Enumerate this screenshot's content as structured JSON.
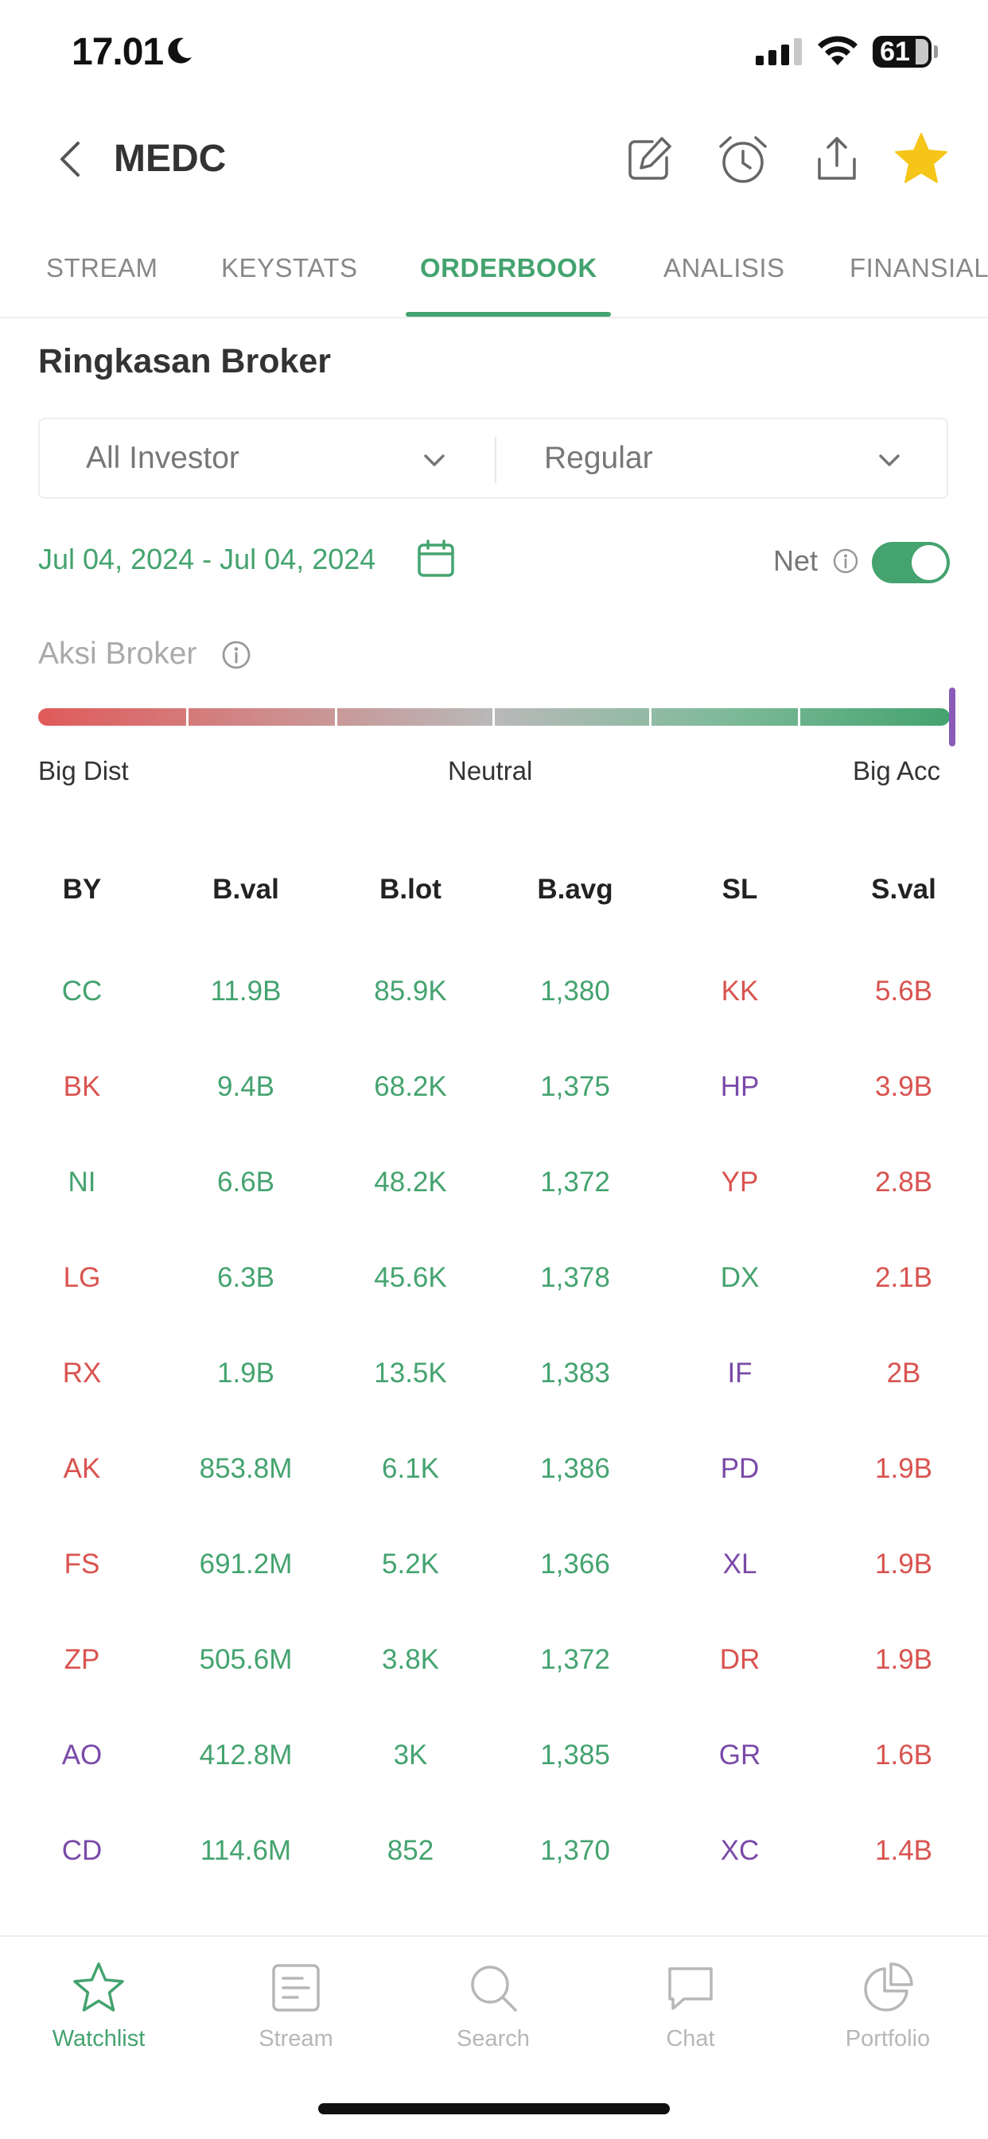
{
  "status_bar": {
    "time": "17.01",
    "battery": "61"
  },
  "header": {
    "ticker": "MEDC"
  },
  "tabs": [
    {
      "label": "STREAM",
      "active": false
    },
    {
      "label": "KEYSTATS",
      "active": false
    },
    {
      "label": "ORDERBOOK",
      "active": true
    },
    {
      "label": "ANALISIS",
      "active": false
    },
    {
      "label": "FINANSIAL",
      "active": false
    }
  ],
  "broker_summary": {
    "title": "Ringkasan Broker",
    "investor_filter": "All Investor",
    "market_filter": "Regular",
    "date_range": "Jul 04, 2024 - Jul 04, 2024",
    "net_label": "Net",
    "net_enabled": true,
    "aksi_label": "Aksi Broker",
    "scale": {
      "left": "Big Dist",
      "center": "Neutral",
      "right": "Big Acc"
    },
    "indicator_level": 1.0
  },
  "table": {
    "headers": [
      "BY",
      "B.val",
      "B.lot",
      "B.avg",
      "SL",
      "S.val"
    ],
    "rows": [
      {
        "by": "CC",
        "by_color": "green",
        "bval": "11.9B",
        "blot": "85.9K",
        "bavg": "1,380",
        "sl": "KK",
        "sl_color": "red",
        "sval": "5.6B"
      },
      {
        "by": "BK",
        "by_color": "red",
        "bval": "9.4B",
        "blot": "68.2K",
        "bavg": "1,375",
        "sl": "HP",
        "sl_color": "purple",
        "sval": "3.9B"
      },
      {
        "by": "NI",
        "by_color": "green",
        "bval": "6.6B",
        "blot": "48.2K",
        "bavg": "1,372",
        "sl": "YP",
        "sl_color": "red",
        "sval": "2.8B"
      },
      {
        "by": "LG",
        "by_color": "red",
        "bval": "6.3B",
        "blot": "45.6K",
        "bavg": "1,378",
        "sl": "DX",
        "sl_color": "green",
        "sval": "2.1B"
      },
      {
        "by": "RX",
        "by_color": "red",
        "bval": "1.9B",
        "blot": "13.5K",
        "bavg": "1,383",
        "sl": "IF",
        "sl_color": "purple",
        "sval": "2B"
      },
      {
        "by": "AK",
        "by_color": "red",
        "bval": "853.8M",
        "blot": "6.1K",
        "bavg": "1,386",
        "sl": "PD",
        "sl_color": "purple",
        "sval": "1.9B"
      },
      {
        "by": "FS",
        "by_color": "red",
        "bval": "691.2M",
        "blot": "5.2K",
        "bavg": "1,366",
        "sl": "XL",
        "sl_color": "purple",
        "sval": "1.9B"
      },
      {
        "by": "ZP",
        "by_color": "red",
        "bval": "505.6M",
        "blot": "3.8K",
        "bavg": "1,372",
        "sl": "DR",
        "sl_color": "red",
        "sval": "1.9B"
      },
      {
        "by": "AO",
        "by_color": "purple",
        "bval": "412.8M",
        "blot": "3K",
        "bavg": "1,385",
        "sl": "GR",
        "sl_color": "purple",
        "sval": "1.6B"
      },
      {
        "by": "CD",
        "by_color": "purple",
        "bval": "114.6M",
        "blot": "852",
        "bavg": "1,370",
        "sl": "XC",
        "sl_color": "purple",
        "sval": "1.4B"
      }
    ]
  },
  "bottom_nav": [
    {
      "label": "Watchlist",
      "icon": "star-outline-icon",
      "active": true
    },
    {
      "label": "Stream",
      "icon": "stream-icon",
      "active": false
    },
    {
      "label": "Search",
      "icon": "search-icon",
      "active": false
    },
    {
      "label": "Chat",
      "icon": "chat-icon",
      "active": false
    },
    {
      "label": "Portfolio",
      "icon": "pie-chart-icon",
      "active": false
    }
  ],
  "colors": {
    "accent": "#44a36f",
    "sell": "#d9534f",
    "neutral_broker": "#7a4aa8",
    "favorite": "#f5c518"
  }
}
